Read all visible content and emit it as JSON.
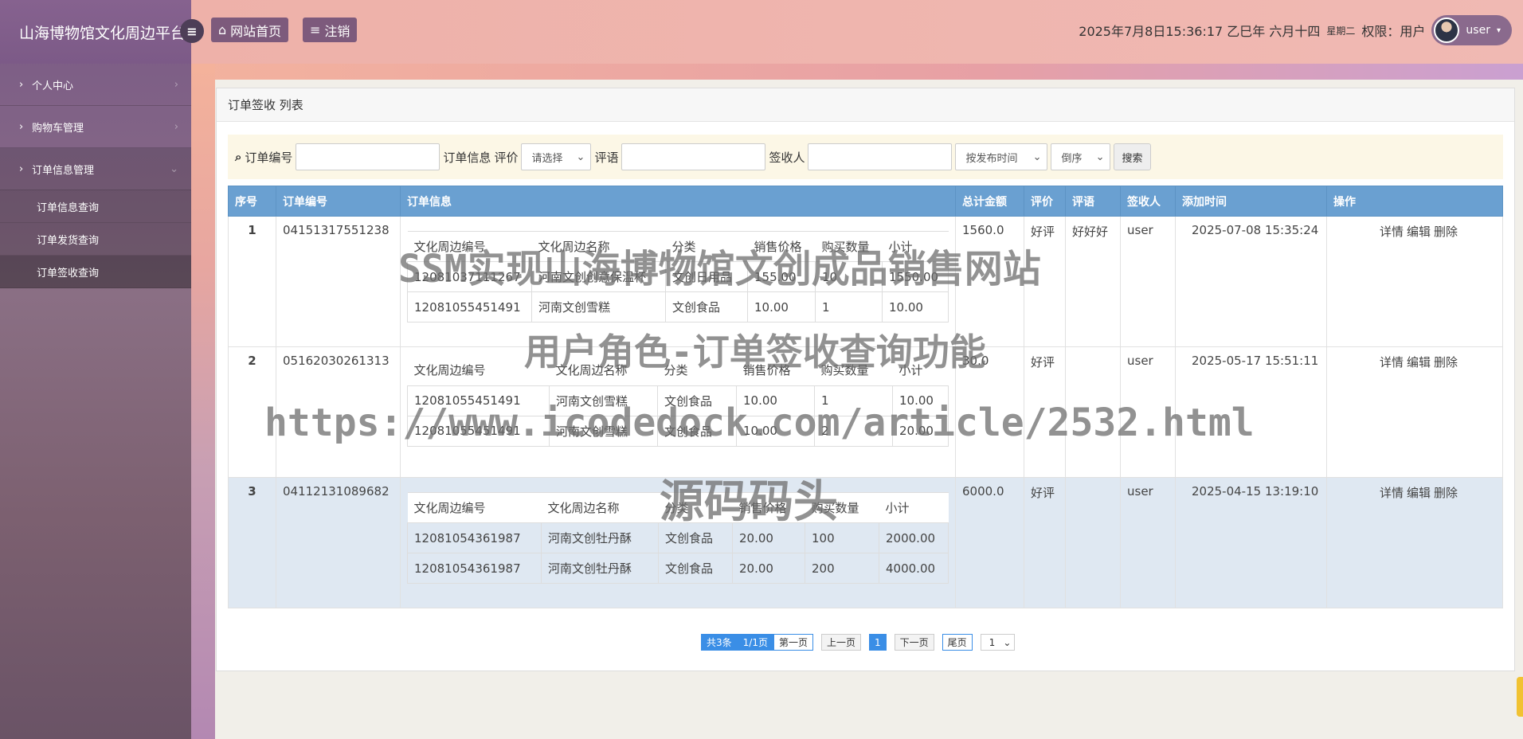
{
  "app": {
    "title": "山海博物馆文化周边平台"
  },
  "sidebar": {
    "items": [
      {
        "label": "个人中心"
      },
      {
        "label": "购物车管理"
      },
      {
        "label": "订单信息管理"
      }
    ],
    "sub_items": [
      {
        "label": "订单信息查询"
      },
      {
        "label": "订单发货查询"
      },
      {
        "label": "订单签收查询"
      }
    ]
  },
  "header": {
    "home_label": "网站首页",
    "logout_label": "注销",
    "datetime": "2025年7月8日15:36:17 乙巳年 六月十四",
    "weekday": "星期二",
    "role": "权限：用户",
    "username": "user"
  },
  "panel": {
    "title": "订单签收 列表"
  },
  "search": {
    "order_no_label": "订单编号",
    "order_info_label": "订单信息",
    "rating_label": "评价",
    "rating_value": "请选择",
    "comment_label": "评语",
    "receiver_label": "签收人",
    "sort_field": "按发布时间",
    "sort_order": "倒序",
    "search_label": "搜索"
  },
  "table": {
    "headers": [
      "序号",
      "订单编号",
      "订单信息",
      "总计金额",
      "评价",
      "评语",
      "签收人",
      "添加时间",
      "操作"
    ],
    "inner_headers": [
      "文化周边编号",
      "文化周边名称",
      "分类",
      "销售价格",
      "购买数量",
      "小计"
    ],
    "ops": [
      "详情",
      "编辑",
      "删除"
    ],
    "rows": [
      {
        "idx": "1",
        "order_no": "04151317551238",
        "total": "1560.0",
        "rating": "好评",
        "comment": "好好好",
        "receiver": "user",
        "time": "2025-07-08 15:35:24",
        "items": [
          [
            "12081037111267",
            "河南文创创意保温杯",
            "文创日用品",
            "155.00",
            "10",
            "1550.00"
          ],
          [
            "12081055451491",
            "河南文创雪糕",
            "文创食品",
            "10.00",
            "1",
            "10.00"
          ]
        ]
      },
      {
        "idx": "2",
        "order_no": "05162030261313",
        "total": "30.0",
        "rating": "好评",
        "comment": "",
        "receiver": "user",
        "time": "2025-05-17 15:51:11",
        "items": [
          [
            "12081055451491",
            "河南文创雪糕",
            "文创食品",
            "10.00",
            "1",
            "10.00"
          ],
          [
            "12081055451491",
            "河南文创雪糕",
            "文创食品",
            "10.00",
            "2",
            "20.00"
          ]
        ]
      },
      {
        "idx": "3",
        "order_no": "04112131089682",
        "total": "6000.0",
        "rating": "好评",
        "comment": "",
        "receiver": "user",
        "time": "2025-04-15 13:19:10",
        "items": [
          [
            "12081054361987",
            "河南文创牡丹酥",
            "文创食品",
            "20.00",
            "100",
            "2000.00"
          ],
          [
            "12081054361987",
            "河南文创牡丹酥",
            "文创食品",
            "20.00",
            "200",
            "4000.00"
          ]
        ]
      }
    ]
  },
  "pager": {
    "total": "共3条",
    "pages": "1/1页",
    "first": "第一页",
    "prev": "上一页",
    "current": "1",
    "next": "下一页",
    "last": "尾页",
    "select": "1"
  },
  "watermark": {
    "line1": "SSM实现山海博物馆文创成品销售网站",
    "line2": "用户角色-订单签收查询功能",
    "line3": "https://www.icodedock.com/article/2532.html",
    "line4": "源码码头"
  }
}
